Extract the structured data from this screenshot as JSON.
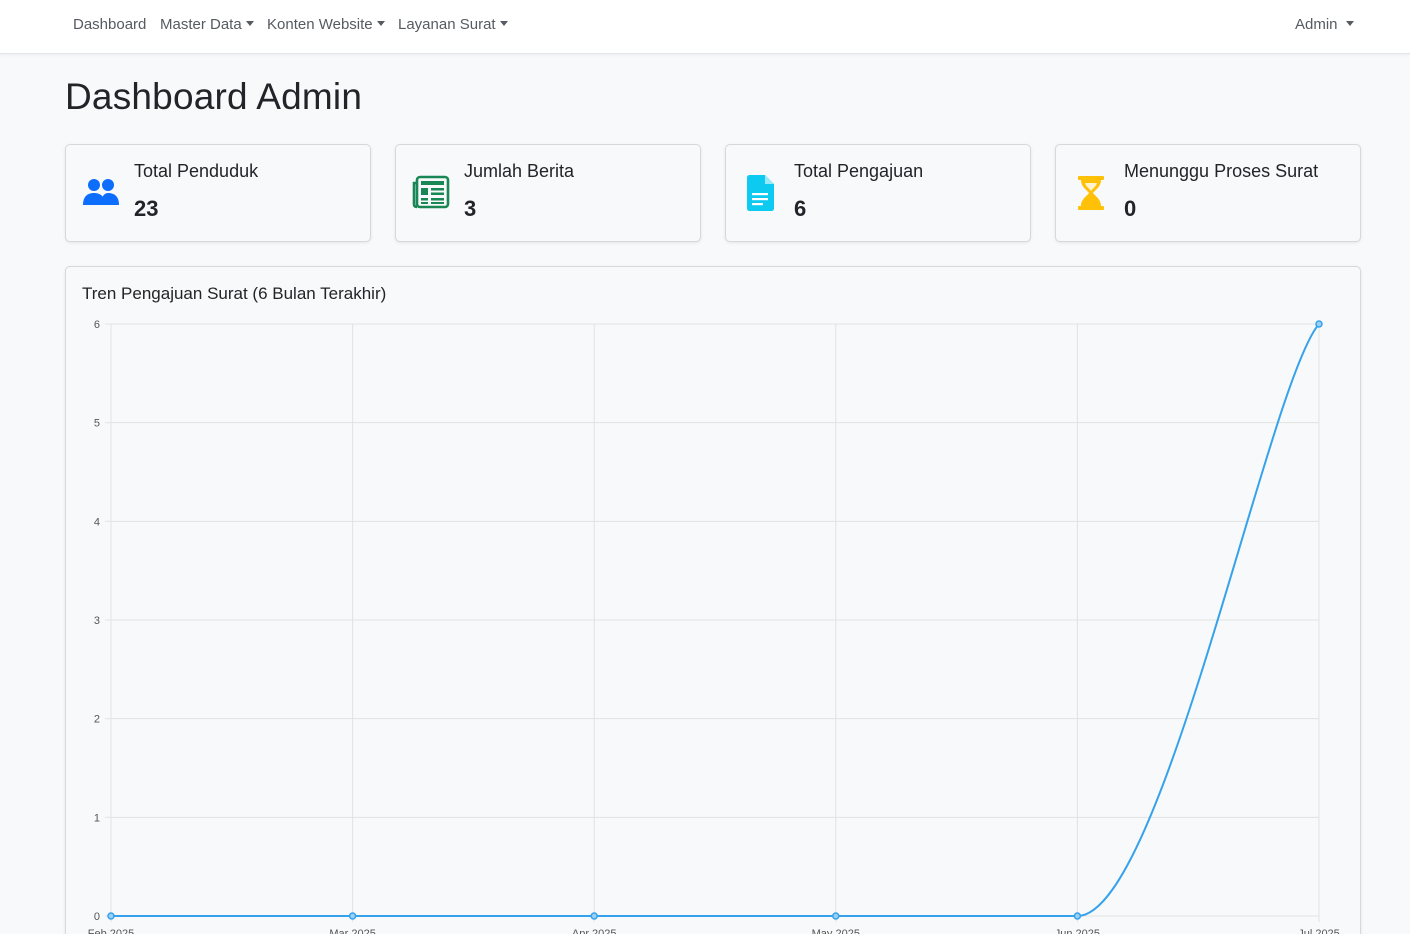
{
  "navbar": {
    "items": [
      {
        "label": "Dashboard",
        "dropdown": false
      },
      {
        "label": "Master Data",
        "dropdown": true
      },
      {
        "label": "Konten Website",
        "dropdown": true
      },
      {
        "label": "Layanan Surat",
        "dropdown": true
      }
    ],
    "user_label": "Admin"
  },
  "page_title": "Dashboard Admin",
  "stats": [
    {
      "label": "Total Penduduk",
      "value": "23",
      "icon": "users-icon",
      "color": "#0d6efd"
    },
    {
      "label": "Jumlah Berita",
      "value": "3",
      "icon": "newspaper-icon",
      "color": "#198754"
    },
    {
      "label": "Total Pengajuan",
      "value": "6",
      "icon": "document-icon",
      "color": "#0dcaf0"
    },
    {
      "label": "Menunggu Proses Surat",
      "value": "0",
      "icon": "hourglass-icon",
      "color": "#ffc107"
    }
  ],
  "chart_title": "Tren Pengajuan Surat (6 Bulan Terakhir)",
  "chart_data": {
    "type": "line",
    "title": "",
    "categories": [
      "Feb 2025",
      "Mar 2025",
      "Apr 2025",
      "May 2025",
      "Jun 2025",
      "Jul 2025"
    ],
    "values": [
      0,
      0,
      0,
      0,
      0,
      6
    ],
    "ylim": [
      0,
      6
    ],
    "yticks": [
      0,
      1,
      2,
      3,
      4,
      5,
      6
    ],
    "xlabel": "",
    "ylabel": "",
    "grid": true,
    "color": "#36a2eb"
  }
}
